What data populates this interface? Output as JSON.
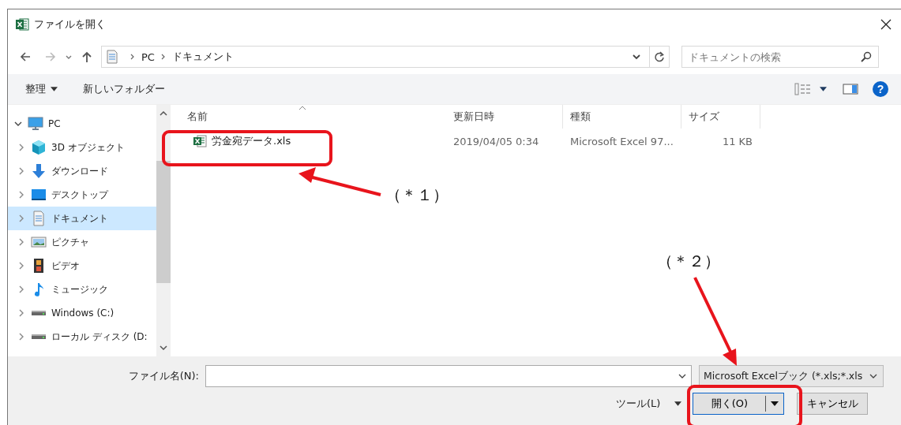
{
  "window": {
    "title": "ファイルを開く"
  },
  "address": {
    "crumbs": [
      "PC",
      "ドキュメント"
    ]
  },
  "search": {
    "placeholder": "ドキュメントの検索"
  },
  "toolbar": {
    "organize": "整理",
    "new_folder": "新しいフォルダー",
    "help": "?"
  },
  "sidebar": {
    "items": [
      {
        "label": "PC",
        "kind": "pc",
        "expanded": true,
        "selected": false,
        "children": [
          {
            "label": "3D オブジェクト",
            "kind": "cube",
            "expanded": false,
            "selected": false
          },
          {
            "label": "ダウンロード",
            "kind": "download",
            "expanded": false,
            "selected": false
          },
          {
            "label": "デスクトップ",
            "kind": "desktop",
            "expanded": false,
            "selected": false
          },
          {
            "label": "ドキュメント",
            "kind": "document",
            "expanded": false,
            "selected": true
          },
          {
            "label": "ピクチャ",
            "kind": "pictures",
            "expanded": false,
            "selected": false
          },
          {
            "label": "ビデオ",
            "kind": "video",
            "expanded": false,
            "selected": false
          },
          {
            "label": "ミュージック",
            "kind": "music",
            "expanded": false,
            "selected": false
          },
          {
            "label": "Windows (C:)",
            "kind": "drive",
            "expanded": false,
            "selected": false
          },
          {
            "label": "ローカル ディスク (D:",
            "kind": "drive",
            "expanded": false,
            "selected": false
          }
        ]
      }
    ]
  },
  "table": {
    "columns": [
      {
        "label": "名前",
        "sorted": true
      },
      {
        "label": "更新日時",
        "sorted": false
      },
      {
        "label": "種類",
        "sorted": false
      },
      {
        "label": "サイズ",
        "sorted": false
      }
    ],
    "rows": [
      {
        "name": "労金宛データ.xls",
        "modified": "2019/04/05 0:34",
        "type": "Microsoft Excel 97...",
        "size": "11 KB",
        "selected": false
      }
    ]
  },
  "file_name": {
    "label": "ファイル名(N):"
  },
  "file_type": {
    "value": "Microsoft Excelブック (*.xls;*.xls"
  },
  "buttons": {
    "tools": "ツール(L)",
    "open": "開く(O)",
    "cancel": "キャンセル"
  },
  "annotations": [
    {
      "label": "（＊１）"
    },
    {
      "label": "（＊２）"
    }
  ]
}
